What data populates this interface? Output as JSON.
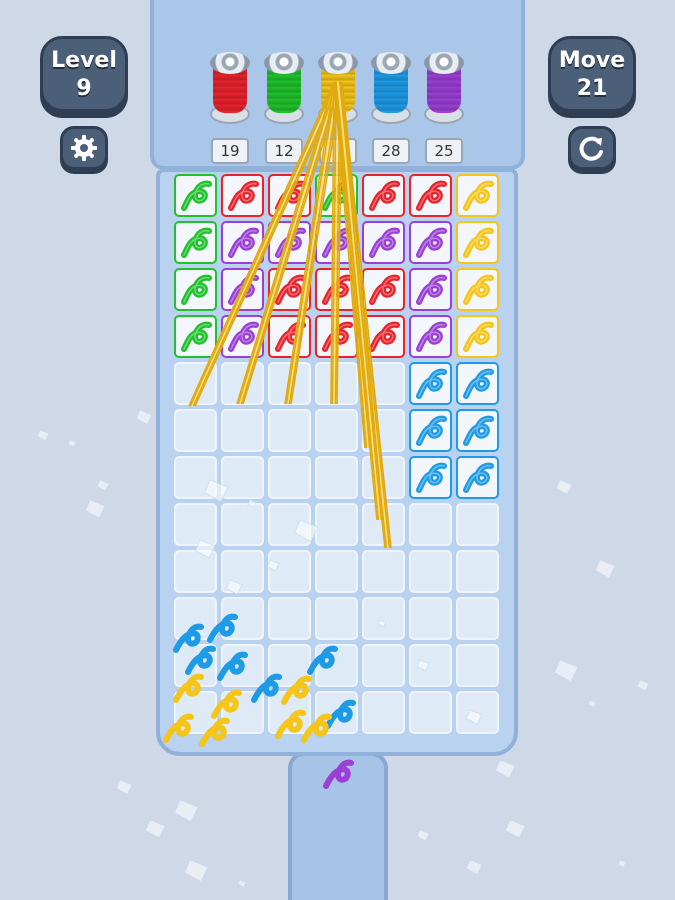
{
  "hud": {
    "level_label": "Level",
    "level_value": "9",
    "move_label": "Move",
    "move_value": "21"
  },
  "icons": {
    "settings": "gear-icon",
    "restart": "restart-icon"
  },
  "colors": {
    "red": "#e8232b",
    "green": "#1fc22b",
    "yellow": "#f5c518",
    "blue": "#1e9be6",
    "purple": "#9b3fd6",
    "empty": "#dfeaf7"
  },
  "spools": [
    {
      "color": "red",
      "count": "19"
    },
    {
      "color": "green",
      "count": "12"
    },
    {
      "color": "yellow",
      "count": ""
    },
    {
      "color": "blue",
      "count": "28"
    },
    {
      "color": "purple",
      "count": "25"
    }
  ],
  "grid": {
    "rows": [
      [
        "green",
        "red",
        "red",
        "green",
        "red",
        "red",
        "yellow"
      ],
      [
        "green",
        "purple",
        "purple",
        "purple",
        "purple",
        "purple",
        "yellow"
      ],
      [
        "green",
        "purple",
        "red",
        "red",
        "red",
        "purple",
        "yellow"
      ],
      [
        "green",
        "purple",
        "red",
        "red",
        "red",
        "purple",
        "yellow"
      ],
      [
        "",
        "",
        "",
        "",
        "",
        "blue",
        "blue"
      ],
      [
        "",
        "",
        "",
        "",
        "",
        "blue",
        "blue"
      ],
      [
        "",
        "",
        "",
        "",
        "",
        "blue",
        "blue"
      ],
      [
        "",
        "",
        "",
        "",
        "",
        "",
        ""
      ],
      [
        "",
        "",
        "",
        "",
        "",
        "",
        ""
      ],
      [
        "",
        "",
        "",
        "",
        "",
        "",
        ""
      ],
      [
        "",
        "",
        "",
        "",
        "",
        "",
        ""
      ],
      [
        "",
        "",
        "",
        "",
        "",
        "",
        ""
      ]
    ]
  }
}
